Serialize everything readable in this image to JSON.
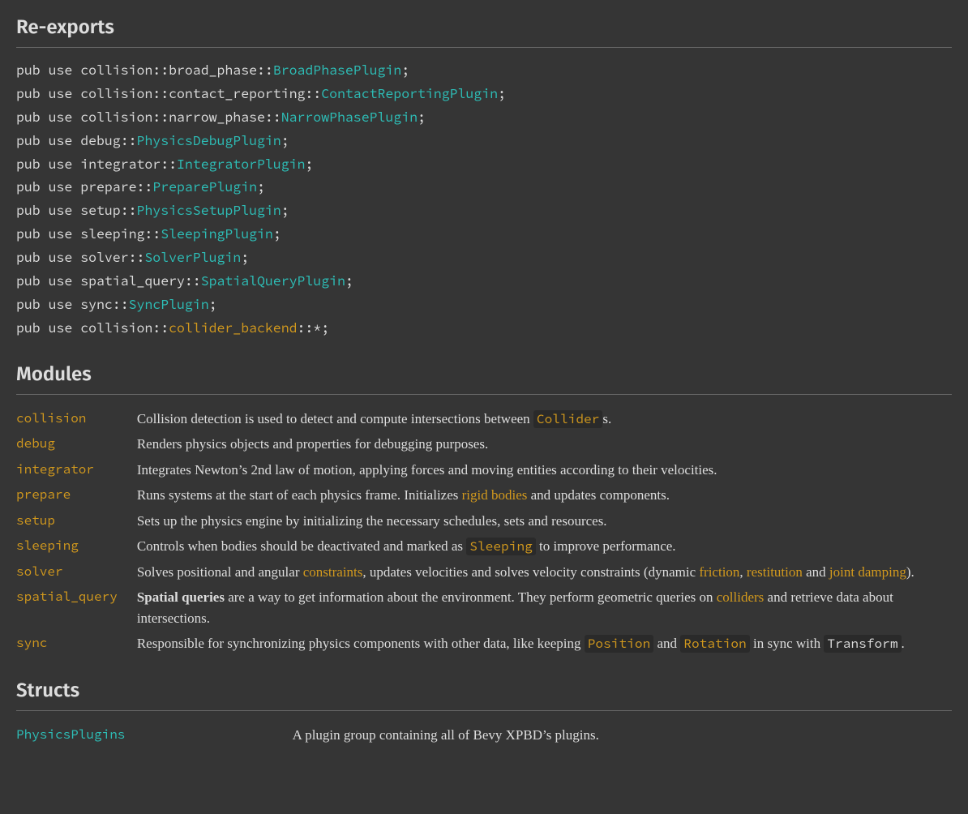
{
  "sections": {
    "reexports": "Re-exports",
    "modules": "Modules",
    "structs": "Structs"
  },
  "reexports": [
    {
      "prefix": "pub use collision::broad_phase::",
      "name": "BroadPhasePlugin",
      "suffix": ";",
      "kind": "struct"
    },
    {
      "prefix": "pub use collision::contact_reporting::",
      "name": "ContactReportingPlugin",
      "suffix": ";",
      "kind": "struct"
    },
    {
      "prefix": "pub use collision::narrow_phase::",
      "name": "NarrowPhasePlugin",
      "suffix": ";",
      "kind": "struct"
    },
    {
      "prefix": "pub use debug::",
      "name": "PhysicsDebugPlugin",
      "suffix": ";",
      "kind": "struct"
    },
    {
      "prefix": "pub use integrator::",
      "name": "IntegratorPlugin",
      "suffix": ";",
      "kind": "struct"
    },
    {
      "prefix": "pub use prepare::",
      "name": "PreparePlugin",
      "suffix": ";",
      "kind": "struct"
    },
    {
      "prefix": "pub use setup::",
      "name": "PhysicsSetupPlugin",
      "suffix": ";",
      "kind": "struct"
    },
    {
      "prefix": "pub use sleeping::",
      "name": "SleepingPlugin",
      "suffix": ";",
      "kind": "struct"
    },
    {
      "prefix": "pub use solver::",
      "name": "SolverPlugin",
      "suffix": ";",
      "kind": "struct"
    },
    {
      "prefix": "pub use spatial_query::",
      "name": "SpatialQueryPlugin",
      "suffix": ";",
      "kind": "struct"
    },
    {
      "prefix": "pub use sync::",
      "name": "SyncPlugin",
      "suffix": ";",
      "kind": "struct"
    },
    {
      "prefix": "pub use collision::",
      "name": "collider_backend",
      "suffix": "::*;",
      "kind": "mod"
    }
  ],
  "modules": [
    {
      "name": "collision",
      "desc": [
        {
          "t": "text",
          "v": "Collision detection is used to detect and compute intersections between "
        },
        {
          "t": "code",
          "v": "Collider"
        },
        {
          "t": "text",
          "v": "s."
        }
      ]
    },
    {
      "name": "debug",
      "desc": [
        {
          "t": "text",
          "v": "Renders physics objects and properties for debugging purposes."
        }
      ]
    },
    {
      "name": "integrator",
      "desc": [
        {
          "t": "text",
          "v": "Integrates Newton’s 2nd law of motion, applying forces and moving entities according to their velocities."
        }
      ]
    },
    {
      "name": "prepare",
      "desc": [
        {
          "t": "text",
          "v": "Runs systems at the start of each physics frame. Initializes "
        },
        {
          "t": "link",
          "v": "rigid bodies"
        },
        {
          "t": "text",
          "v": " and updates components."
        }
      ]
    },
    {
      "name": "setup",
      "desc": [
        {
          "t": "text",
          "v": "Sets up the physics engine by initializing the necessary schedules, sets and resources."
        }
      ]
    },
    {
      "name": "sleeping",
      "desc": [
        {
          "t": "text",
          "v": "Controls when bodies should be deactivated and marked as "
        },
        {
          "t": "code",
          "v": "Sleeping"
        },
        {
          "t": "text",
          "v": " to improve performance."
        }
      ]
    },
    {
      "name": "solver",
      "desc": [
        {
          "t": "text",
          "v": "Solves positional and angular "
        },
        {
          "t": "link",
          "v": "constraints"
        },
        {
          "t": "text",
          "v": ", updates velocities and solves velocity constraints (dynamic "
        },
        {
          "t": "link",
          "v": "friction"
        },
        {
          "t": "text",
          "v": ", "
        },
        {
          "t": "link",
          "v": "restitution"
        },
        {
          "t": "text",
          "v": " and "
        },
        {
          "t": "link",
          "v": "joint damping"
        },
        {
          "t": "text",
          "v": ")."
        }
      ]
    },
    {
      "name": "spatial_query",
      "desc": [
        {
          "t": "bold",
          "v": "Spatial queries"
        },
        {
          "t": "text",
          "v": " are a way to get information about the environment. They perform geometric queries on "
        },
        {
          "t": "link",
          "v": "colliders"
        },
        {
          "t": "text",
          "v": " and retrieve data about intersections."
        }
      ]
    },
    {
      "name": "sync",
      "desc": [
        {
          "t": "text",
          "v": "Responsible for synchronizing physics components with other data, like keeping "
        },
        {
          "t": "code",
          "v": "Position"
        },
        {
          "t": "text",
          "v": " and "
        },
        {
          "t": "code",
          "v": "Rotation"
        },
        {
          "t": "text",
          "v": " in sync with "
        },
        {
          "t": "code-plain",
          "v": "Transform"
        },
        {
          "t": "text",
          "v": "."
        }
      ]
    }
  ],
  "structs": [
    {
      "name": "PhysicsPlugins",
      "desc": [
        {
          "t": "text",
          "v": "A plugin group containing all of Bevy XPBD’s plugins."
        }
      ]
    }
  ]
}
